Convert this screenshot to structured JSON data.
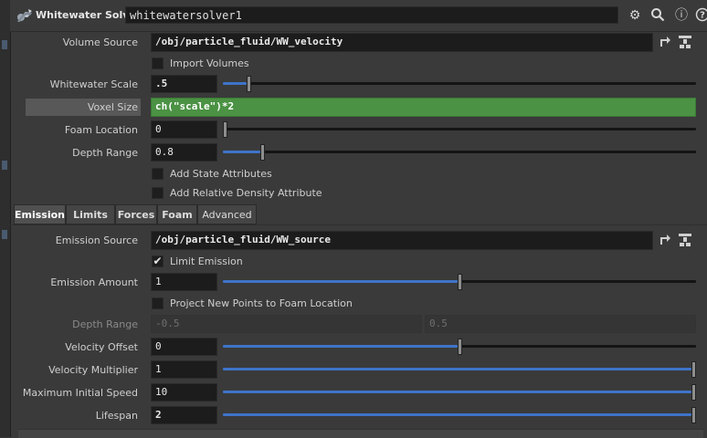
{
  "header": {
    "node_type": "Whitewater Solver",
    "node_name": "whitewatersolver1",
    "icons": [
      "gear-icon",
      "search-icon",
      "info-icon",
      "help-icon"
    ],
    "icon_glyphs": {
      "gear": "⚙",
      "search": "🔍",
      "info": "ⓘ",
      "help": "?"
    }
  },
  "params": {
    "volume_source": {
      "label": "Volume Source",
      "value": "/obj/particle_fluid/WW_velocity"
    },
    "import_volumes": {
      "label": "Import Volumes",
      "checked": false
    },
    "whitewater_scale": {
      "label": "Whitewater Scale",
      "value": ".5",
      "slider_fraction": 0.05
    },
    "voxel_size": {
      "label": "Voxel Size",
      "value": "ch(\"scale\")*2"
    },
    "foam_location": {
      "label": "Foam Location",
      "value": "0",
      "slider_fraction": 0.0
    },
    "depth_range": {
      "label": "Depth Range",
      "value": "0.8",
      "slider_fraction": 0.08
    },
    "add_state_attributes": {
      "label": "Add State Attributes",
      "checked": false
    },
    "add_relative_density": {
      "label": "Add Relative Density Attribute",
      "checked": false
    }
  },
  "tabs": [
    {
      "label": "Emission",
      "active": true
    },
    {
      "label": "Limits",
      "active": false
    },
    {
      "label": "Forces",
      "active": false
    },
    {
      "label": "Foam",
      "active": false
    },
    {
      "label": "Advanced",
      "active": false
    }
  ],
  "emission": {
    "emission_source": {
      "label": "Emission Source",
      "value": "/obj/particle_fluid/WW_source"
    },
    "limit_emission": {
      "label": "Limit Emission",
      "checked": true,
      "check_glyph": "✔"
    },
    "emission_amount": {
      "label": "Emission Amount",
      "value": "1",
      "slider_fraction": 0.5
    },
    "project_new_points": {
      "label": "Project New Points to Foam Location",
      "checked": false
    },
    "depth_range": {
      "label": "Depth Range",
      "min": "-0.5",
      "max": "0.5",
      "disabled": true
    },
    "velocity_offset": {
      "label": "Velocity Offset",
      "value": "0",
      "slider_fraction": 0.5
    },
    "velocity_multiplier": {
      "label": "Velocity Multiplier",
      "value": "1",
      "slider_fraction": 1.0
    },
    "max_initial_speed": {
      "label": "Maximum Initial Speed",
      "value": "10",
      "slider_fraction": 1.0
    },
    "lifespan": {
      "label": "Lifespan",
      "value": "2",
      "slider_fraction": 1.0
    }
  },
  "colors": {
    "accent_blue": "#3f74c9",
    "expression_green": "#4b9244",
    "background": "#3a3a3a",
    "field_bg": "#1c1c1c"
  }
}
